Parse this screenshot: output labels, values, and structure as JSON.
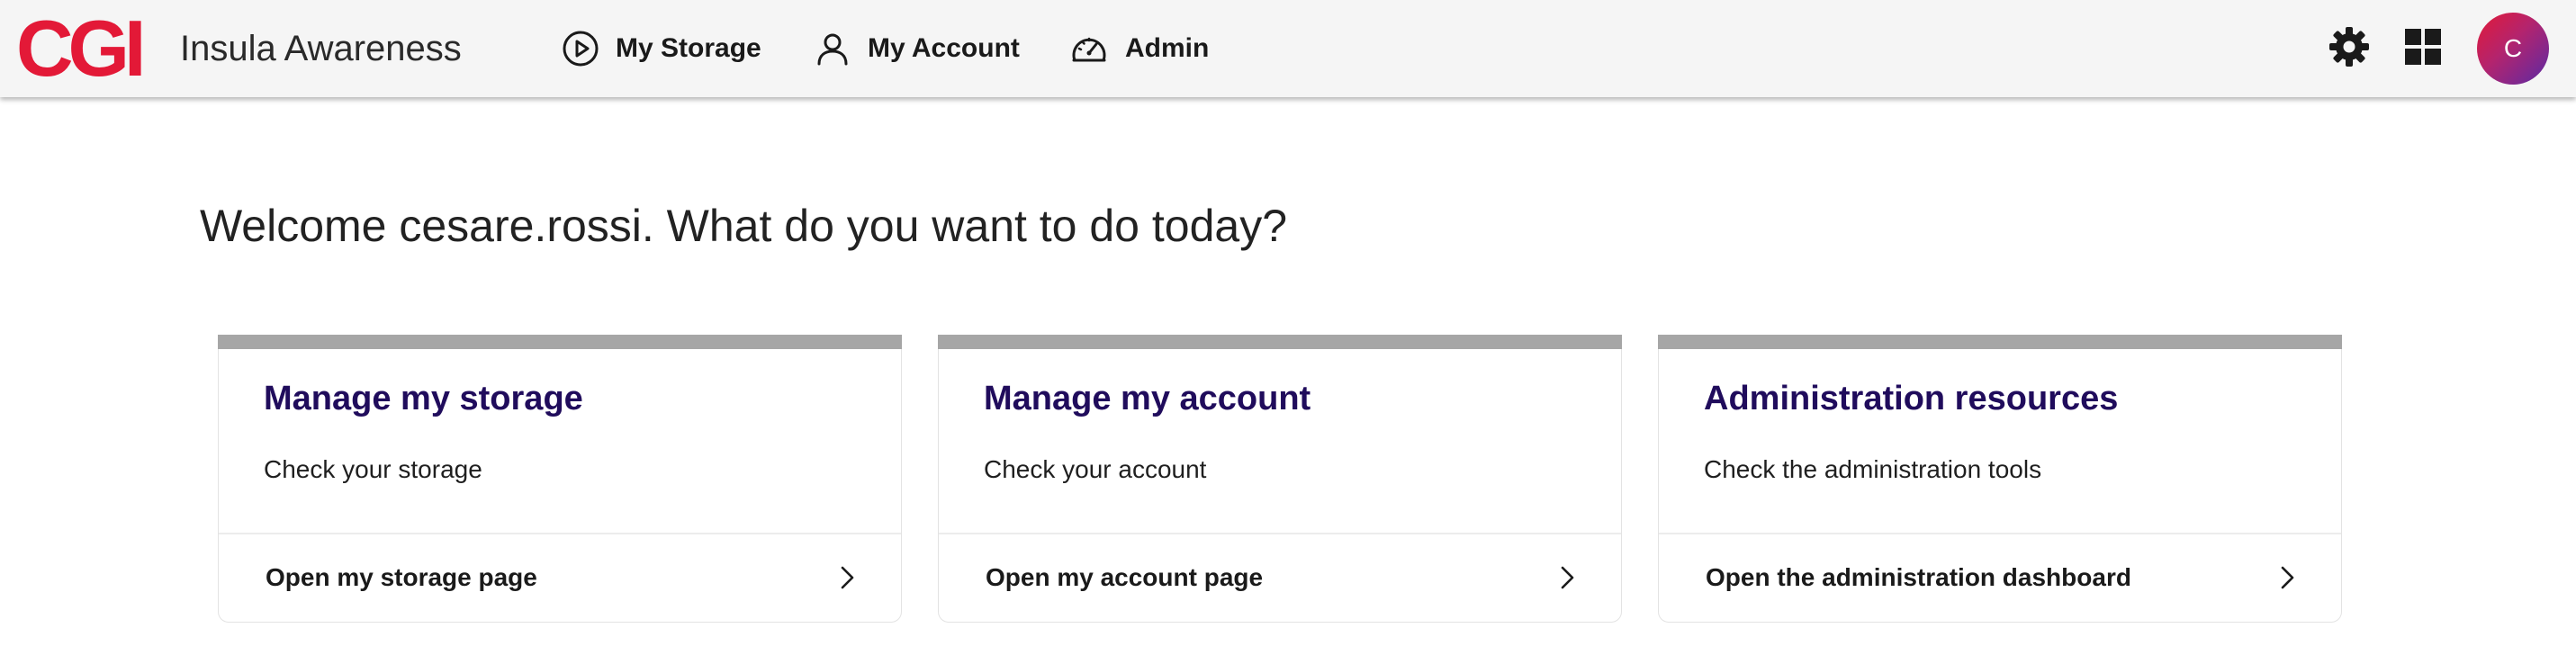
{
  "brand": {
    "logo_text": "CGI",
    "logo_color": "#e31937"
  },
  "header": {
    "app_title": "Insula Awareness",
    "background": "#f5f5f5",
    "nav": [
      {
        "label": "My Storage",
        "icon": "play-circle-icon"
      },
      {
        "label": "My Account",
        "icon": "user-icon"
      },
      {
        "label": "Admin",
        "icon": "speedometer-icon"
      }
    ],
    "tools": {
      "settings_icon": "gear-icon",
      "apps_icon": "grid-icon"
    },
    "avatar": {
      "initial": "C",
      "gradient": [
        "#e31937",
        "#5a2aa5"
      ]
    }
  },
  "main": {
    "welcome": "Welcome cesare.rossi. What do you want to do today?",
    "cards": [
      {
        "title": "Manage my storage",
        "description": "Check your storage",
        "link_label": "Open my storage page"
      },
      {
        "title": "Manage my account",
        "description": "Check your account",
        "link_label": "Open my account page"
      },
      {
        "title": "Administration resources",
        "description": "Check the administration tools",
        "link_label": "Open the administration dashboard"
      }
    ]
  },
  "colors": {
    "card_title": "#200c5c",
    "card_top_bar": "#a6a6a6"
  }
}
